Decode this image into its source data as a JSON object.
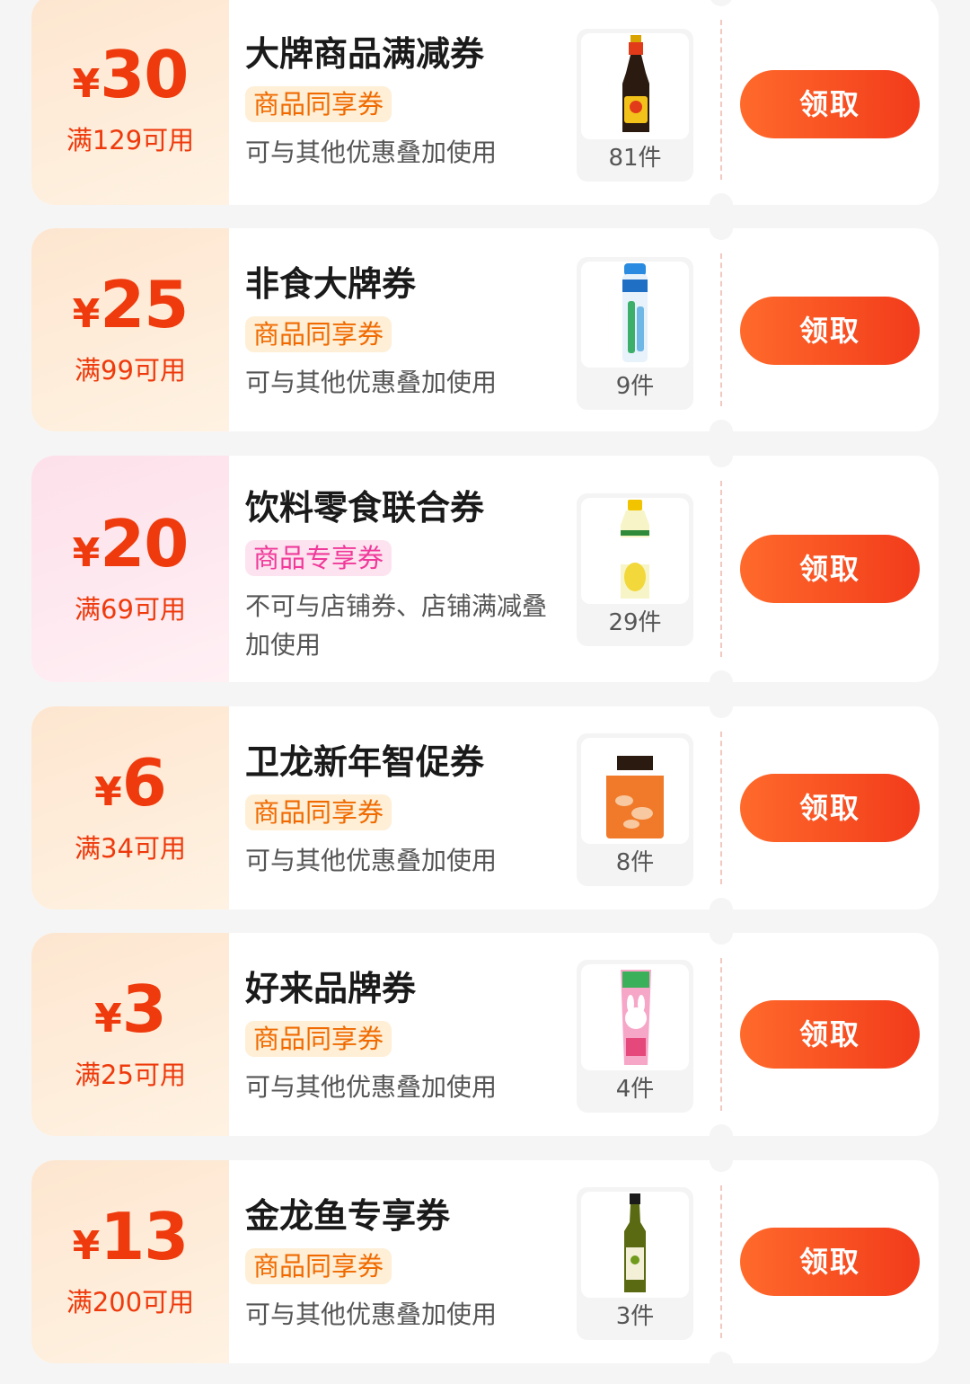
{
  "coupons": [
    {
      "currency": "¥",
      "amount": "30",
      "threshold": "满129可用",
      "title": "大牌商品满减券",
      "tag": "商品同享券",
      "description": "可与其他优惠叠加使用",
      "product_icon": "soy-sauce-bottle-icon",
      "item_count": "81件",
      "button_label": "领取",
      "theme": "orange"
    },
    {
      "currency": "¥",
      "amount": "25",
      "threshold": "满99可用",
      "title": "非食大牌券",
      "tag": "商品同享券",
      "description": "可与其他优惠叠加使用",
      "product_icon": "toothpaste-tube-icon",
      "item_count": "9件",
      "button_label": "领取",
      "theme": "orange"
    },
    {
      "currency": "¥",
      "amount": "20",
      "threshold": "满69可用",
      "title": "饮料零食联合券",
      "tag": "商品专享券",
      "description": "不可与店铺券、店铺满减叠加使用",
      "product_icon": "juice-bottle-icon",
      "item_count": "29件",
      "button_label": "领取",
      "theme": "pink"
    },
    {
      "currency": "¥",
      "amount": "6",
      "threshold": "满34可用",
      "title": "卫龙新年智促券",
      "tag": "商品同享券",
      "description": "可与其他优惠叠加使用",
      "product_icon": "snack-bag-icon",
      "item_count": "8件",
      "button_label": "领取",
      "theme": "orange"
    },
    {
      "currency": "¥",
      "amount": "3",
      "threshold": "满25可用",
      "title": "好来品牌券",
      "tag": "商品同享券",
      "description": "可与其他优惠叠加使用",
      "product_icon": "kids-toothpaste-box-icon",
      "item_count": "4件",
      "button_label": "领取",
      "theme": "orange"
    },
    {
      "currency": "¥",
      "amount": "13",
      "threshold": "满200可用",
      "title": "金龙鱼专享券",
      "tag": "商品同享券",
      "description": "可与其他优惠叠加使用",
      "product_icon": "olive-oil-bottle-icon",
      "item_count": "3件",
      "button_label": "领取",
      "theme": "orange"
    }
  ],
  "colors": {
    "accent": "#ee3a0c",
    "button_gradient_start": "#ff6a2b",
    "button_gradient_end": "#f23b1b",
    "tag_orange_text": "#f06a00",
    "tag_pink_text": "#f0399a"
  }
}
